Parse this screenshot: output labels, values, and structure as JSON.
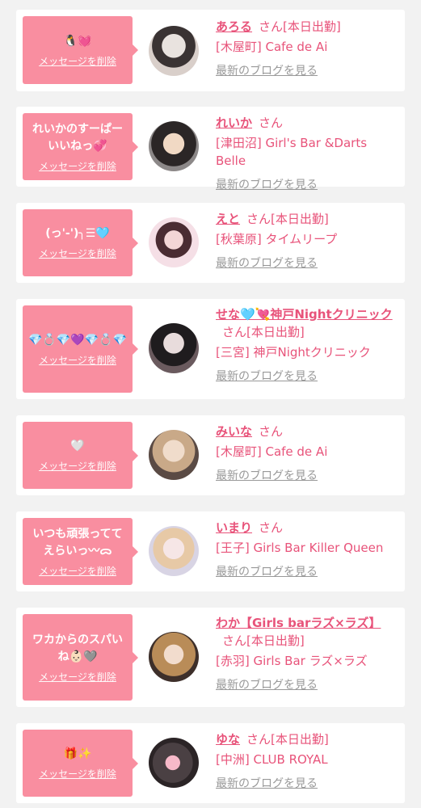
{
  "delete_label": "メッセージを削除",
  "blog_label": "最新のブログを見る",
  "san_label": "さん",
  "colors": {
    "accent": "#e8537a",
    "bubble": "#f98ea0",
    "background": "#f2f2f2"
  },
  "cards": [
    {
      "message": "🐧💓",
      "name": "あろる",
      "status": "[本日出勤]",
      "shop": "[木屋町] Cafe de Ai"
    },
    {
      "message": "れいかのすーぱーいいねっ💞",
      "name": "れいか",
      "status": "",
      "shop": "[津田沼] Girl's Bar &Darts Belle"
    },
    {
      "message": "(っ'-')╮☰🩵",
      "name": "えと",
      "status": "[本日出勤]",
      "shop": "[秋葉原] タイムリープ"
    },
    {
      "message": "💎💍💎💜💎💍💎",
      "name": "せな🩵💘神戸Nightクリニック",
      "status": "[本日出勤]",
      "shop": "[三宮] 神戸Nightクリニック"
    },
    {
      "message": "🤍",
      "name": "みいな",
      "status": "",
      "shop": "[木屋町] Cafe de Ai"
    },
    {
      "message": "いつも頑張っててえらいっ〰︎ᯅ",
      "name": "いまり",
      "status": "",
      "shop": "[王子] Girls Bar Killer Queen"
    },
    {
      "message": "ワカからのスパいね👶🏻🩶",
      "name": "わか【Girls barラズ×ラズ】",
      "status": "[本日出勤]",
      "shop": "[赤羽] Girls Bar ラズ×ラズ"
    },
    {
      "message": "🎁✨",
      "name": "ゆな",
      "status": "[本日出勤]",
      "shop": "[中洲] CLUB ROYAL"
    }
  ]
}
